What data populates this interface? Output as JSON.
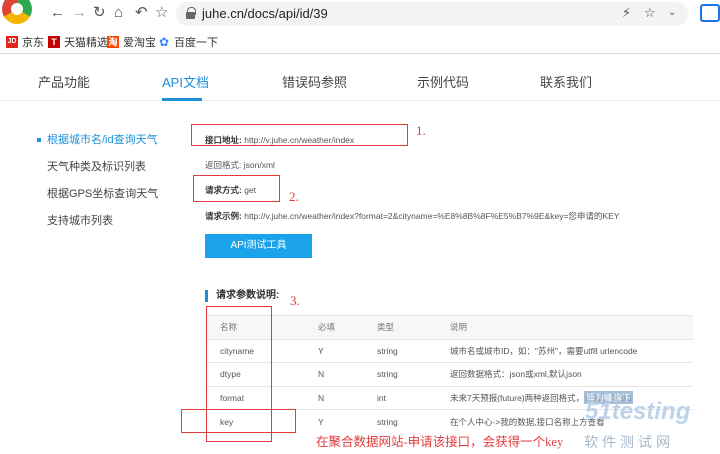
{
  "browser": {
    "url": "juhe.cn/docs/api/id/39",
    "bookmarks": [
      {
        "label": "京东",
        "icon": "JD",
        "color": "#e1251b"
      },
      {
        "label": "天猫精选",
        "icon": "T",
        "color": "#c40000"
      },
      {
        "label": "爱淘宝",
        "icon": "淘",
        "color": "#ff4400"
      },
      {
        "label": "百度一下",
        "icon": "baidu-paw-icon",
        "color": "#3385ff"
      }
    ]
  },
  "site_nav": {
    "tabs": [
      {
        "label": "产品功能"
      },
      {
        "label": "API文档"
      },
      {
        "label": "错误码参照"
      },
      {
        "label": "示例代码"
      },
      {
        "label": "联系我们"
      }
    ],
    "active_tab": "API文档"
  },
  "sidebar": {
    "items": [
      {
        "label": "根据城市名/id查询天气"
      },
      {
        "label": "天气种类及标识列表"
      },
      {
        "label": "根据GPS坐标查询天气"
      },
      {
        "label": "支持城市列表"
      }
    ]
  },
  "api": {
    "endpoint_label": "接口地址:",
    "endpoint_value": "http://v.juhe.cn/weather/index",
    "format_label": "返回格式:",
    "format_value": "json/xml",
    "method_label": "请求方式:",
    "method_value": "get",
    "example_label": "请求示例:",
    "example_value": "http://v.juhe.cn/weather/index?format=2&cityname=%E8%8B%8F%E5%B7%9E&key=您申请的KEY",
    "test_button": "API测试工具",
    "params_title": "请求参数说明:"
  },
  "params_table": {
    "headers": [
      "名称",
      "必填",
      "类型",
      "说明"
    ],
    "rows": [
      [
        "cityname",
        "Y",
        "string",
        "城市名或城市ID，如：\"苏州\"，需要utf8 urlencode"
      ],
      [
        "dtype",
        "N",
        "string",
        "返回数据格式：json或xml,默认json"
      ],
      [
        "format",
        "N",
        "int",
        "未来7天预报(future)两种返回格式，1或2，默认1"
      ],
      [
        "key",
        "Y",
        "string",
        "在个人中心->我的数据,接口名称上方查看"
      ]
    ]
  },
  "annotations": {
    "n1": "1.",
    "n2": "2.",
    "n3": "3.",
    "caption": "在聚合数据网站-申请该接口，会获得一个key",
    "color": "#e23b3b"
  },
  "watermark": {
    "brand": "51testing",
    "subtitle": "软件测试网",
    "tag": "博为峰旗下"
  }
}
